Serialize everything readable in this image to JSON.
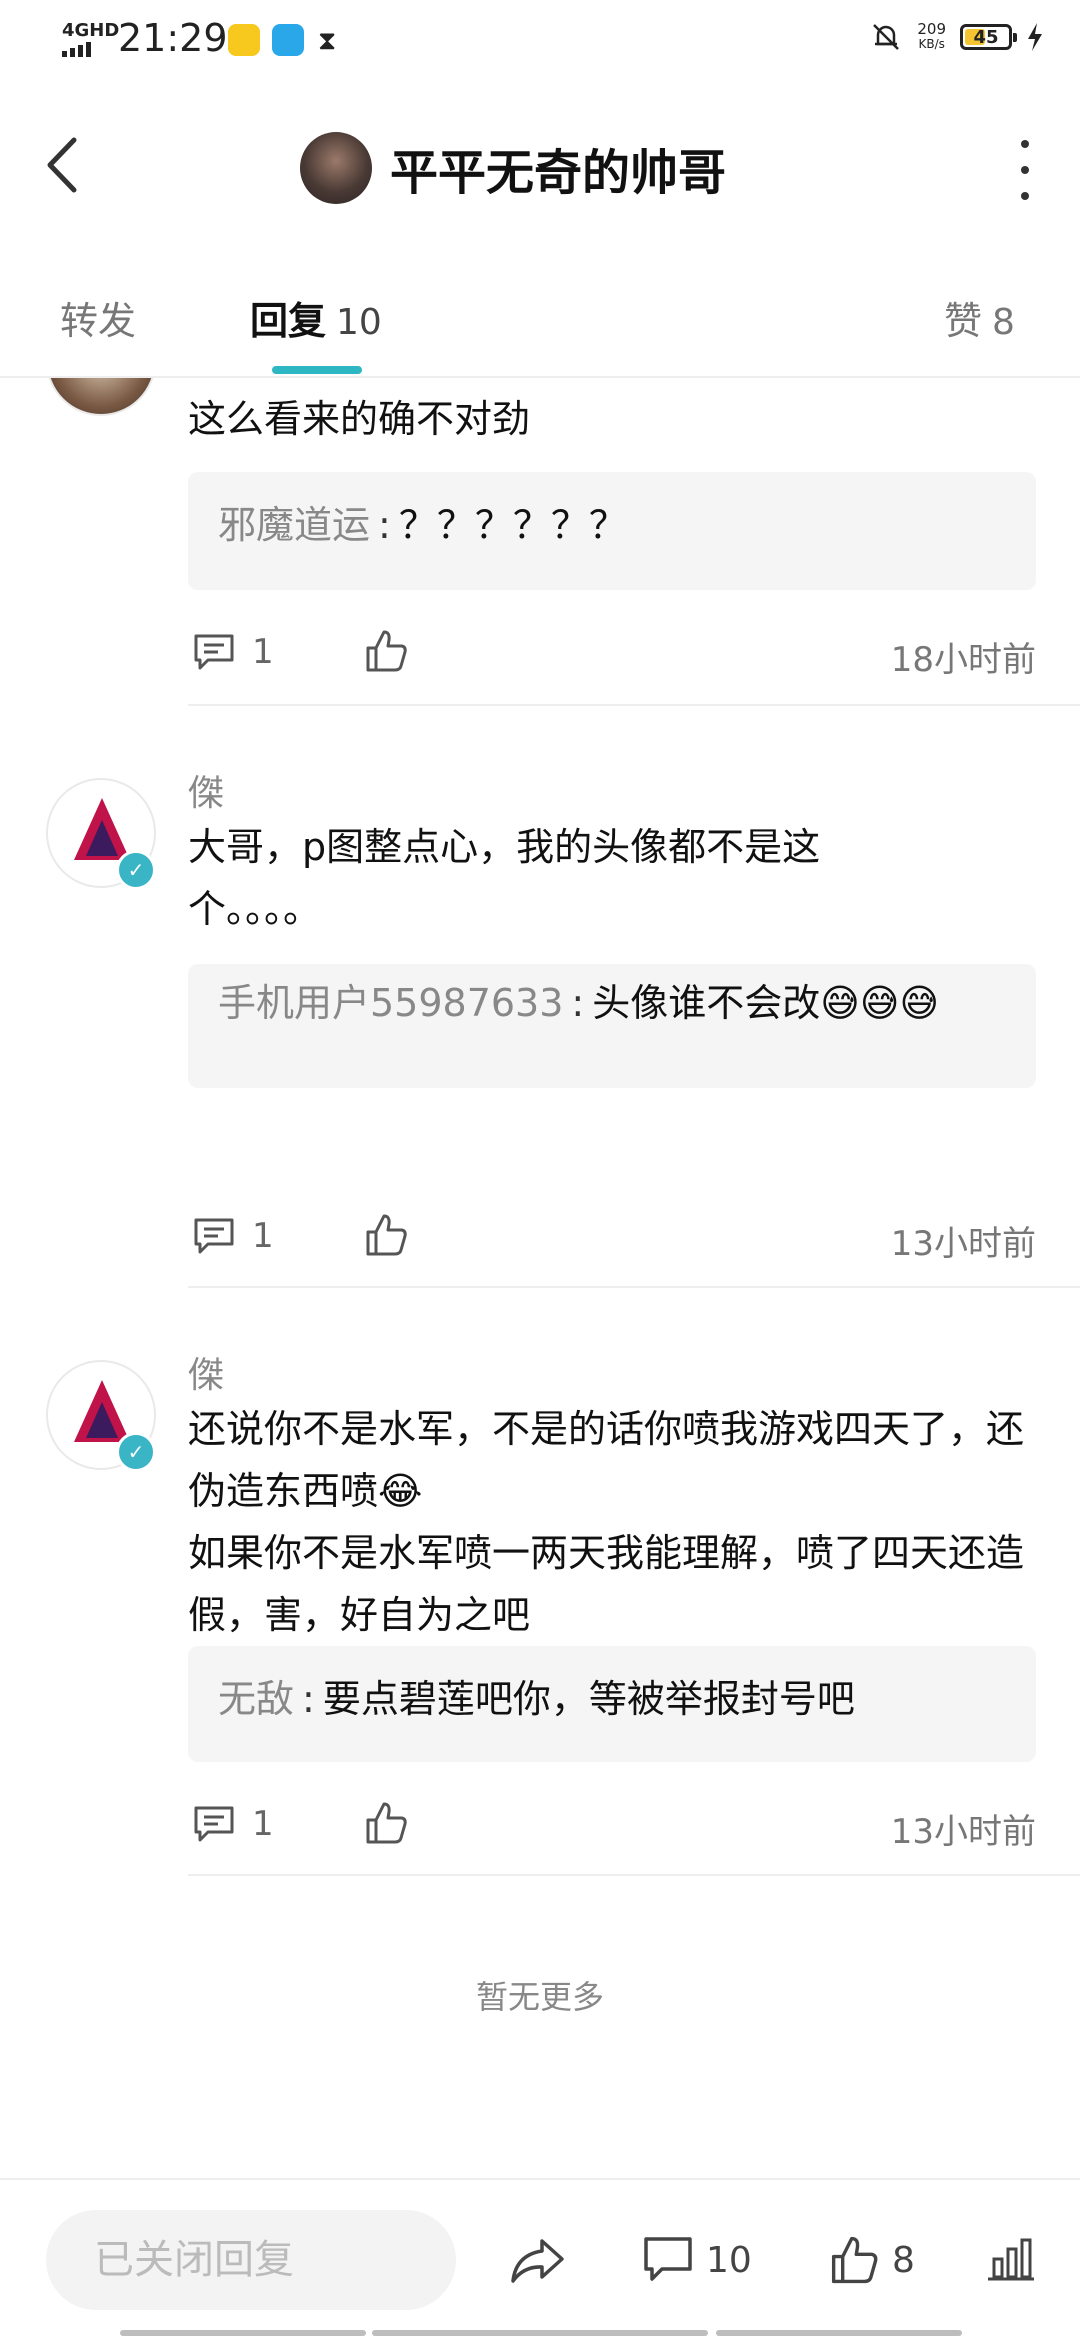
{
  "status_bar": {
    "network": "4GHD",
    "time": "21:29",
    "speed_value": "209",
    "speed_unit": "KB/s",
    "battery": "45",
    "accent_battery": "#f5c531"
  },
  "header": {
    "title": "平平无奇的帅哥",
    "back_icon": "chevron-left-icon",
    "more_icon": "more-vertical-icon"
  },
  "tabs": {
    "forward": {
      "label": "转发"
    },
    "replies": {
      "label": "回复",
      "count": "10"
    },
    "likes": {
      "label": "赞",
      "count": "8"
    },
    "active_color": "#2db7c2"
  },
  "comments": [
    {
      "name": "",
      "text": "这么看来的确不对劲",
      "reply": {
        "user": "邪魔道运",
        "sep": ":",
        "text": "？？？？？？"
      },
      "reply_count": "1",
      "time": "18小时前"
    },
    {
      "name": "傑",
      "text": "大哥，p图整点心，我的头像都不是这个。。。。",
      "reply": {
        "user": "手机用户55987633",
        "sep": ":",
        "text": "头像谁不会改😅😅😅"
      },
      "reply_count": "1",
      "time": "13小时前"
    },
    {
      "name": "傑",
      "text": "还说你不是水军，不是的话你喷我游戏四天了，还伪造东西喷😂\n如果你不是水军喷一两天我能理解，喷了四天还造假，害，好自为之吧",
      "reply": {
        "user": "无敌",
        "sep": ":",
        "text": "要点碧莲吧你，等被举报封号吧"
      },
      "reply_count": "1",
      "time": "13小时前"
    }
  ],
  "no_more": "暂无更多",
  "bottom_bar": {
    "reply_closed": "已关闭回复",
    "comment_count": "10",
    "like_count": "8"
  }
}
